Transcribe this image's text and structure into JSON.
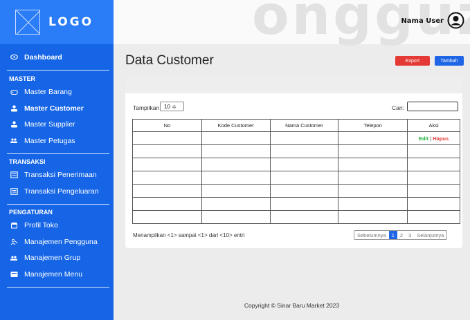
{
  "brand": {
    "logo_text": "LOGO"
  },
  "header": {
    "user_name": "Nama User",
    "watermark": "ongguz"
  },
  "sidebar": {
    "dashboard": "Dashboard",
    "master_title": "MASTER",
    "master_items": [
      "Master Barang",
      "Master Customer",
      "Master Supplier",
      "Master Petugas"
    ],
    "transaksi_title": "TRANSAKSI",
    "transaksi_items": [
      "Transaksi Penerimaan",
      "Transaksi Pengeluaran"
    ],
    "pengaturan_title": "PENGATURAN",
    "pengaturan_items": [
      "Profil Toko",
      "Manajemen Pengguna",
      "Manajemen Grup",
      "Manajemen Menu"
    ]
  },
  "main": {
    "title": "Data Customer",
    "export_label": "Export",
    "add_label": "Tambah",
    "show_label": "Tampilkan",
    "show_value": "10 ≑",
    "search_label": "Cari:",
    "columns": [
      "No",
      "Kode Customer",
      "Nama Customer",
      "Telepon",
      "Aksi"
    ],
    "edit_label": "Edit",
    "delete_label": "Hapus",
    "action_separator": "|",
    "info": "Menampilkan <1> sampai <1> dari <10> entri",
    "pager": {
      "prev": "Sebelumnya",
      "pages": [
        "1",
        "2",
        "3"
      ],
      "next": "Selanjutnya"
    }
  },
  "footer": {
    "copyright": "Copyright © Sinar Baru Market 2023"
  },
  "colors": {
    "sidebar": "#1565e6",
    "export": "#e53935",
    "add": "#1e66e6",
    "edit": "#1fae3a"
  }
}
